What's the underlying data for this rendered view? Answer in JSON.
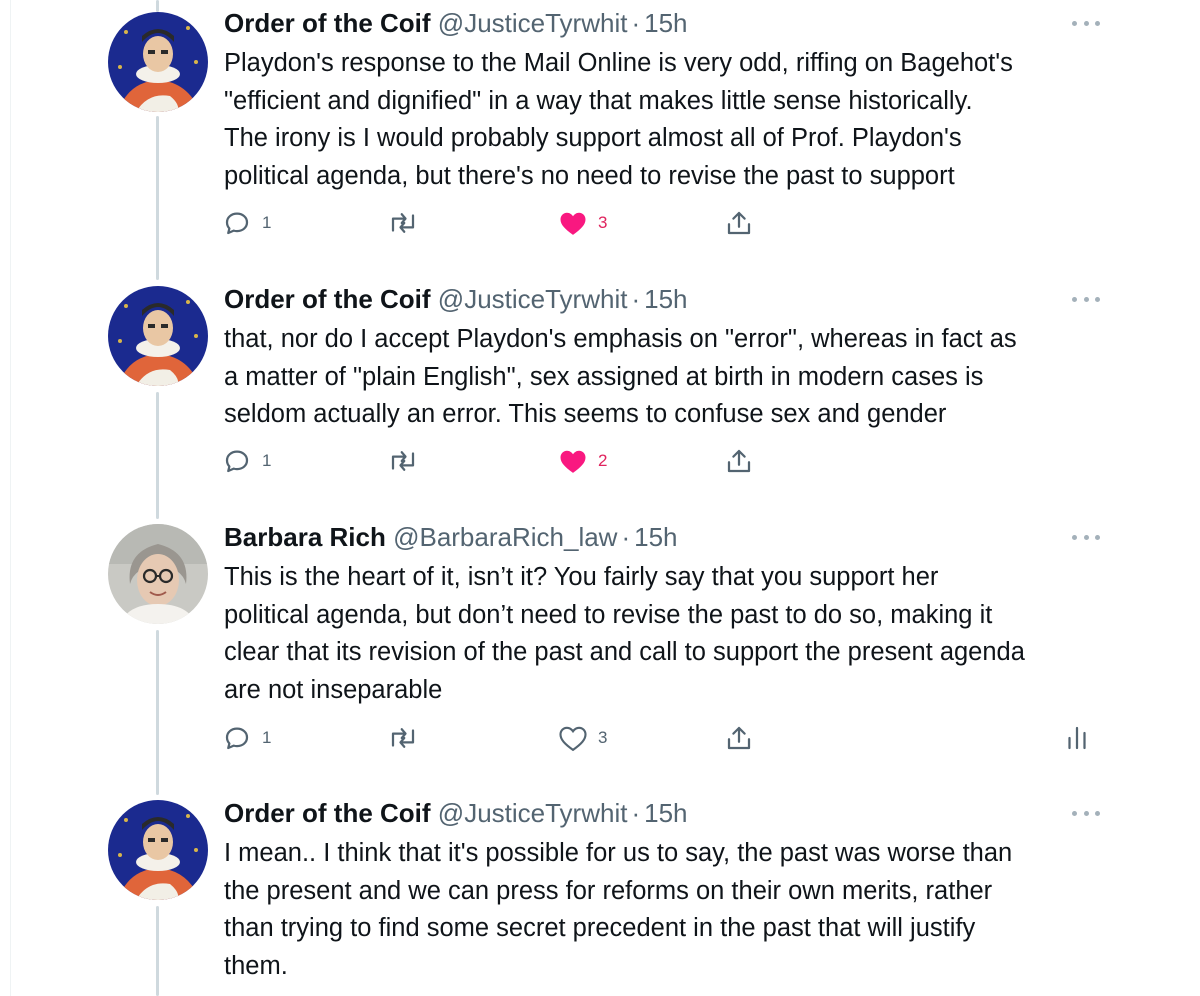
{
  "tweets": [
    {
      "name": "Order of the Coif",
      "handle": "@JusticeTyrwhit",
      "separator": "·",
      "time": "15h",
      "lines": [
        "Playdon's response to the Mail Online is very odd, riffing on Bagehot's",
        "\"efficient and dignified\" in a way that makes little sense historically.",
        "The irony is I would probably support almost all of Prof. Playdon's",
        "political agenda, but there's no need to revise the past to support"
      ],
      "replies": "1",
      "likes": "3",
      "liked": true
    },
    {
      "name": "Order of the Coif",
      "handle": "@JusticeTyrwhit",
      "separator": "·",
      "time": "15h",
      "lines": [
        "that, nor do I accept Playdon's emphasis on \"error\", whereas in fact as",
        "a matter of \"plain English\", sex assigned at birth in modern cases is",
        "seldom actually an error. This seems to confuse sex and gender"
      ],
      "replies": "1",
      "likes": "2",
      "liked": true
    },
    {
      "name": "Barbara Rich",
      "handle": "@BarbaraRich_law",
      "separator": "·",
      "time": "15h",
      "lines": [
        "This is the heart of it, isn’t it? You fairly say that you support her",
        "political agenda, but don’t need to revise the past to do so, making it",
        "clear that its revision of the past and call to support the present agenda",
        "are not inseparable"
      ],
      "replies": "1",
      "likes": "3",
      "liked": false,
      "analytics": true
    },
    {
      "name": "Order of the Coif",
      "handle": "@JusticeTyrwhit",
      "separator": "·",
      "time": "15h",
      "lines": [
        "I mean.. I think that it's possible for us to say, the past was worse than",
        "the present and we can press for reforms on their own merits, rather",
        "than trying to find some secret precedent in the past that will justify",
        "them."
      ]
    }
  ],
  "colors": {
    "like_pink": "#f91880",
    "like_count": "#e0245e",
    "secondary_text": "#536471",
    "thread_line": "#cfd9de"
  },
  "icons": [
    "reply-icon",
    "retweet-icon",
    "heart-icon",
    "share-icon",
    "more-icon",
    "analytics-icon"
  ]
}
